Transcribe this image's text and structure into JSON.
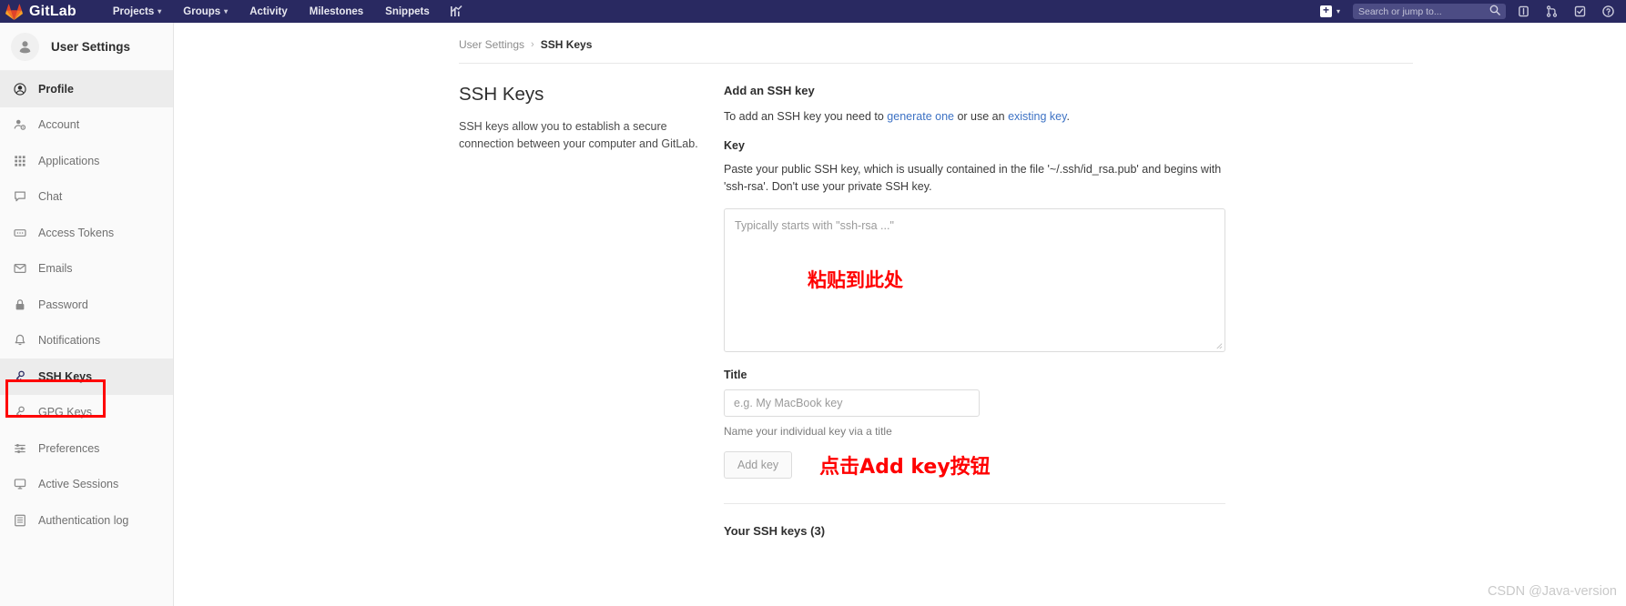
{
  "navbar": {
    "brand": "GitLab",
    "logo_icon": "gitlab-fox-logo",
    "links": [
      {
        "label": "Projects",
        "caret": "⌄",
        "has_caret": true
      },
      {
        "label": "Groups",
        "caret": "⌄",
        "has_caret": true
      },
      {
        "label": "Activity",
        "has_caret": false
      },
      {
        "label": "Milestones",
        "has_caret": false
      },
      {
        "label": "Snippets",
        "has_caret": false
      }
    ],
    "chart_icon": "chart-icon",
    "plus": {
      "glyph": "+",
      "caret": "⌄",
      "icon": "plus-square-icon"
    },
    "search": {
      "placeholder": "Search or jump to...",
      "value": "",
      "icon": "search-icon"
    },
    "right_icons": [
      "issues-board-icon",
      "merge-requests-icon",
      "todos-icon",
      "help-icon"
    ],
    "background_color": "#292961"
  },
  "sidebar": {
    "title": "User Settings",
    "avatar_icon": "user-avatar-icon",
    "items": [
      {
        "label": "Profile",
        "icon": "profile-icon",
        "active": true
      },
      {
        "label": "Account",
        "icon": "account-icon",
        "active": false
      },
      {
        "label": "Applications",
        "icon": "applications-grid-icon",
        "active": false
      },
      {
        "label": "Chat",
        "icon": "chat-bubble-icon",
        "active": false
      },
      {
        "label": "Access Tokens",
        "icon": "access-token-icon",
        "active": false
      },
      {
        "label": "Emails",
        "icon": "envelope-icon",
        "active": false
      },
      {
        "label": "Password",
        "icon": "lock-icon",
        "active": false
      },
      {
        "label": "Notifications",
        "icon": "bell-icon",
        "active": false
      },
      {
        "label": "SSH Keys",
        "icon": "key-icon",
        "active": false,
        "highlighted": true
      },
      {
        "label": "GPG Keys",
        "icon": "key-icon",
        "active": false
      },
      {
        "label": "Preferences",
        "icon": "preferences-sliders-icon",
        "active": false
      },
      {
        "label": "Active Sessions",
        "icon": "monitor-icon",
        "active": false
      },
      {
        "label": "Authentication log",
        "icon": "log-list-icon",
        "active": false
      }
    ],
    "highlight_color": "#ff0000"
  },
  "breadcrumb": {
    "parent": "User Settings",
    "separator": "›",
    "current": "SSH Keys"
  },
  "page": {
    "heading": "SSH Keys",
    "description": "SSH keys allow you to establish a secure connection between your computer and GitLab."
  },
  "form": {
    "section_title": "Add an SSH key",
    "intro_prefix": "To add an SSH key you need to ",
    "intro_link1": "generate one",
    "intro_middle": " or use an ",
    "intro_link2": "existing key",
    "intro_suffix": ".",
    "key_label": "Key",
    "key_help": "Paste your public SSH key, which is usually contained in the file '~/.ssh/id_rsa.pub' and begins with 'ssh-rsa'. Don't use your private SSH key.",
    "key_placeholder": "Typically starts with \"ssh-rsa ...\"",
    "key_value": "",
    "title_label": "Title",
    "title_placeholder": "e.g. My MacBook key",
    "title_value": "",
    "title_hint": "Name your individual key via a title",
    "submit_label": "Add key"
  },
  "annotations": {
    "paste_here": "粘贴到此处",
    "click_add_key": "点击Add key按钮",
    "color": "#ff0000"
  },
  "keys_list": {
    "heading": "Your SSH keys (3)"
  },
  "watermark": "CSDN @Java-version"
}
